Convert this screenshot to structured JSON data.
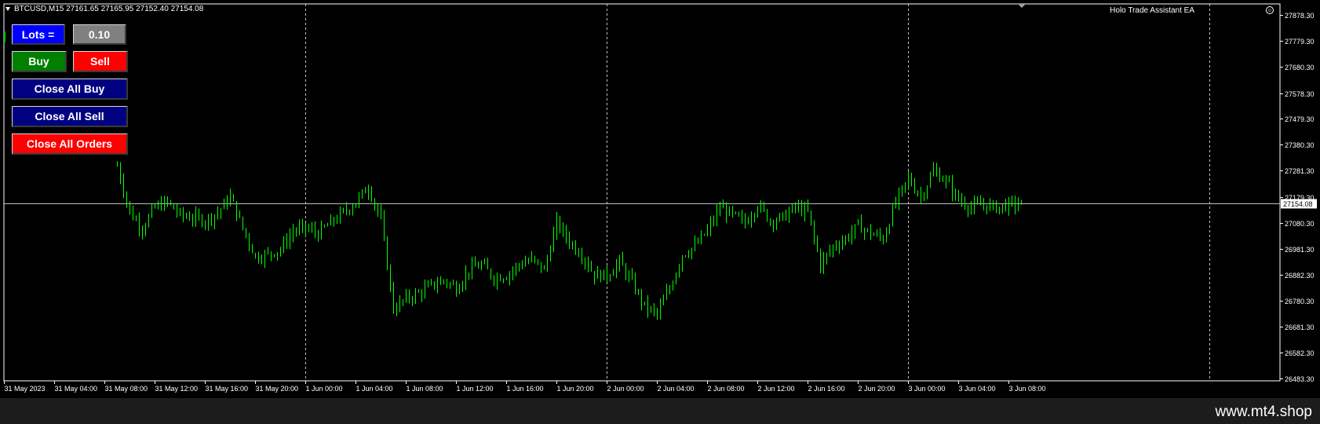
{
  "window": {
    "title": "BTCUSD,M15  27161.65 27165.95 27152.40 27154.08",
    "ea_name": "Holo Trade Assistant EA",
    "ea_icon": "smiley-icon"
  },
  "panel": {
    "lots_label": "Lots =",
    "lots_value": "0.10",
    "buy_label": "Buy",
    "sell_label": "Sell",
    "close_buy_label": "Close All Buy",
    "close_sell_label": "Close All Sell",
    "close_all_label": "Close All Orders"
  },
  "colors": {
    "background": "#000000",
    "candle": "#00ff00",
    "grid": "#c0c0c0",
    "bid_line": "#c0c0c0",
    "lots_button": "#0000ff",
    "buy_button": "#008000",
    "sell_button": "#ff0000",
    "close_buttons": "#000080",
    "close_all_button": "#ff0000"
  },
  "chart_data": {
    "type": "line",
    "symbol": "BTCUSD",
    "timeframe": "M15",
    "current_price": "27154.08",
    "ylim": [
      26483.3,
      27878.3
    ],
    "yticks": [
      "27878.30",
      "27779.30",
      "27680.30",
      "27578.30",
      "27479.30",
      "27380.30",
      "27281.30",
      "27179.30",
      "27080.30",
      "26981.30",
      "26882.30",
      "26780.30",
      "26681.30",
      "26582.30",
      "26483.30"
    ],
    "xticks": [
      "31 May 2023",
      "31 May 04:00",
      "31 May 08:00",
      "31 May 12:00",
      "31 May 16:00",
      "31 May 20:00",
      "1 Jun 00:00",
      "1 Jun 04:00",
      "1 Jun 08:00",
      "1 Jun 12:00",
      "1 Jun 16:00",
      "1 Jun 20:00",
      "2 Jun 00:00",
      "2 Jun 04:00",
      "2 Jun 08:00",
      "2 Jun 12:00",
      "2 Jun 16:00",
      "2 Jun 20:00",
      "3 Jun 00:00",
      "3 Jun 04:00",
      "3 Jun 08:00"
    ],
    "day_separators": [
      "1 Jun 00:00",
      "2 Jun 00:00",
      "3 Jun 00:00",
      "4 Jun 00:00"
    ],
    "grid": false,
    "series": [
      {
        "x": [
          "31 May 09:00",
          "31 May 10:00",
          "31 May 11:00",
          "31 May 12:00",
          "31 May 13:00",
          "31 May 14:00",
          "31 May 15:00",
          "31 May 16:00",
          "31 May 17:00",
          "31 May 18:00",
          "31 May 19:00",
          "31 May 20:00",
          "31 May 21:00",
          "31 May 22:00",
          "31 May 23:00",
          "1 Jun 00:00",
          "1 Jun 01:00",
          "1 Jun 02:00",
          "1 Jun 03:00",
          "1 Jun 04:00",
          "1 Jun 05:00",
          "1 Jun 06:00",
          "1 Jun 07:00",
          "1 Jun 08:00",
          "1 Jun 09:00",
          "1 Jun 10:00",
          "1 Jun 11:00",
          "1 Jun 12:00",
          "1 Jun 13:00",
          "1 Jun 14:00",
          "1 Jun 15:00",
          "1 Jun 16:00",
          "1 Jun 17:00",
          "1 Jun 18:00",
          "1 Jun 19:00",
          "1 Jun 20:00",
          "1 Jun 21:00",
          "1 Jun 22:00",
          "1 Jun 23:00",
          "2 Jun 00:00",
          "2 Jun 01:00",
          "2 Jun 02:00",
          "2 Jun 03:00",
          "2 Jun 04:00",
          "2 Jun 05:00",
          "2 Jun 06:00",
          "2 Jun 07:00",
          "2 Jun 08:00",
          "2 Jun 09:00",
          "2 Jun 10:00",
          "2 Jun 11:00",
          "2 Jun 12:00",
          "2 Jun 13:00",
          "2 Jun 14:00",
          "2 Jun 15:00",
          "2 Jun 16:00",
          "2 Jun 17:00",
          "2 Jun 18:00",
          "2 Jun 19:00",
          "2 Jun 20:00",
          "2 Jun 21:00",
          "2 Jun 22:00",
          "2 Jun 23:00",
          "3 Jun 00:00",
          "3 Jun 01:00",
          "3 Jun 02:00",
          "3 Jun 03:00",
          "3 Jun 04:00",
          "3 Jun 05:00",
          "3 Jun 06:00",
          "3 Jun 07:00",
          "3 Jun 08:00",
          "3 Jun 09:00"
        ],
        "values": [
          27300,
          27120,
          27060,
          27140,
          27160,
          27110,
          27100,
          27090,
          27120,
          27180,
          27060,
          26950,
          26960,
          26980,
          27050,
          27060,
          27040,
          27080,
          27120,
          27160,
          27220,
          27090,
          26750,
          26790,
          26810,
          26840,
          26860,
          26830,
          26900,
          26920,
          26870,
          26880,
          26920,
          26940,
          26900,
          27080,
          27010,
          26960,
          26880,
          26880,
          26930,
          26850,
          26760,
          26730,
          26830,
          26960,
          26990,
          27050,
          27140,
          27110,
          27080,
          27150,
          27090,
          27100,
          27140,
          27120,
          26920,
          26990,
          27020,
          27070,
          27040,
          27020,
          27160,
          27250,
          27180,
          27280,
          27240,
          27170,
          27140,
          27150,
          27140,
          27150,
          27154
        ]
      }
    ]
  },
  "footer": {
    "watermark": "www.mt4.shop"
  }
}
